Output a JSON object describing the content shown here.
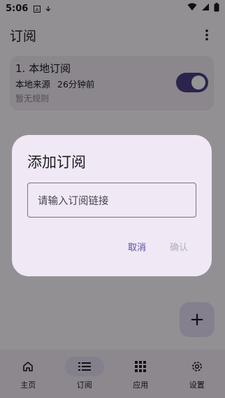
{
  "status_bar": {
    "time": "5:06",
    "icons": [
      "sim-a-icon",
      "download-icon",
      "wifi-icon",
      "signal-icon",
      "battery-icon"
    ]
  },
  "app_bar": {
    "title": "订阅",
    "menu_icon": "more-vert-icon"
  },
  "subscriptions": [
    {
      "name": "1. 本地订阅",
      "source": "本地来源",
      "time_ago": "26分钟前",
      "rules": "暂无规则",
      "enabled": true
    }
  ],
  "fab": {
    "icon": "add-icon",
    "label": "+"
  },
  "bottom_nav": [
    {
      "label": "主页",
      "icon": "home-icon",
      "active": false
    },
    {
      "label": "订阅",
      "icon": "list-icon",
      "active": true
    },
    {
      "label": "应用",
      "icon": "apps-grid-icon",
      "active": false
    },
    {
      "label": "设置",
      "icon": "settings-gear-icon",
      "active": false
    }
  ],
  "dialog": {
    "title": "添加订阅",
    "input_placeholder": "请输入订阅链接",
    "cancel_label": "取消",
    "confirm_label": "确认"
  },
  "colors": {
    "accent": "#4a3f86",
    "surface": "#fdf8fe",
    "card": "#efe8f2",
    "dialog": "#f0e8f5",
    "cancel_text": "#5a4c9e",
    "confirm_disabled_text": "#b3aebb"
  }
}
